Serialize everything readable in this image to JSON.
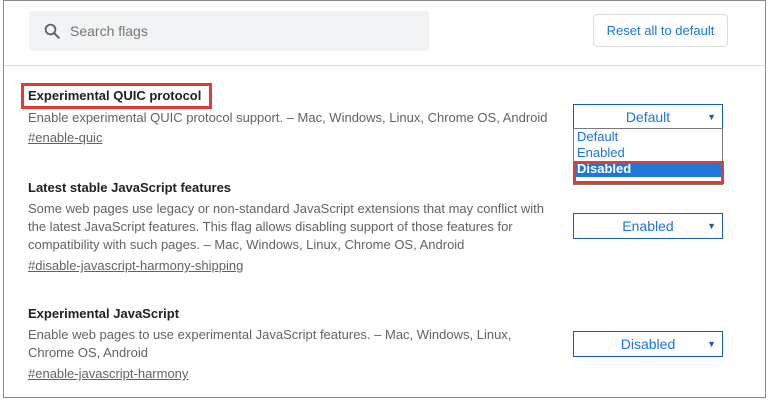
{
  "search": {
    "placeholder": "Search flags"
  },
  "header": {
    "reset_label": "Reset all to default"
  },
  "flags": [
    {
      "title": "Experimental QUIC protocol",
      "description": "Enable experimental QUIC protocol support. – Mac, Windows, Linux, Chrome OS, Android",
      "link": "#enable-quic",
      "value": "Default"
    },
    {
      "title": "Latest stable JavaScript features",
      "description": "Some web pages use legacy or non-standard JavaScript extensions that may conflict with the latest JavaScript features. This flag allows disabling support of those features for compatibility with such pages. – Mac, Windows, Linux, Chrome OS, Android",
      "link": "#disable-javascript-harmony-shipping",
      "value": "Enabled"
    },
    {
      "title": "Experimental JavaScript",
      "description": "Enable web pages to use experimental JavaScript features. – Mac, Windows, Linux, Chrome OS, Android",
      "link": "#enable-javascript-harmony",
      "value": "Disabled"
    }
  ],
  "dropdown": {
    "options": [
      "Default",
      "Enabled",
      "Disabled"
    ],
    "highlighted": "Disabled"
  },
  "colors": {
    "accent": "#1a73e8",
    "highlight_border": "#e53935",
    "selected_bg": "#1e78d7"
  }
}
